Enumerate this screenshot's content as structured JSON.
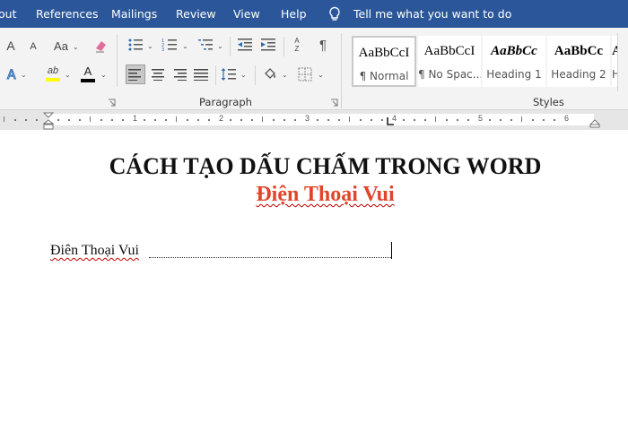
{
  "ribbon_tabs": [
    "out",
    "References",
    "Mailings",
    "Review",
    "View",
    "Help"
  ],
  "tell_me": "Tell me what you want to do",
  "font_group": {
    "grow_font": "A",
    "shrink_font": "A",
    "change_case": "Aa",
    "highlight_label": "ab",
    "font_color_label": "A",
    "highlight_color": "#ffff00",
    "font_color": "#000000"
  },
  "paragraph_group": {
    "label": "Paragraph",
    "sort_label": "A Z",
    "pilcrow": "¶"
  },
  "styles_group": {
    "label": "Styles",
    "items": [
      {
        "sample": "AaBbCcI",
        "name": "¶ Normal"
      },
      {
        "sample": "AaBbCcI",
        "name": "¶ No Spac..."
      },
      {
        "sample": "AaBbCc",
        "name": "Heading 1"
      },
      {
        "sample": "AaBbCc",
        "name": "Heading 2"
      },
      {
        "sample": "Aa",
        "name": "H"
      }
    ]
  },
  "ruler": {
    "numbers": [
      "1",
      "2",
      "3",
      "4",
      "5",
      "6"
    ]
  },
  "document": {
    "title": "CÁCH TẠO DẤU CHẤM TRONG WORD",
    "subtitle": "Điện Thoại Vui",
    "line_text": "Điên Thoại Vui",
    "title_color": "#111111",
    "subtitle_color": "#e0452b"
  }
}
